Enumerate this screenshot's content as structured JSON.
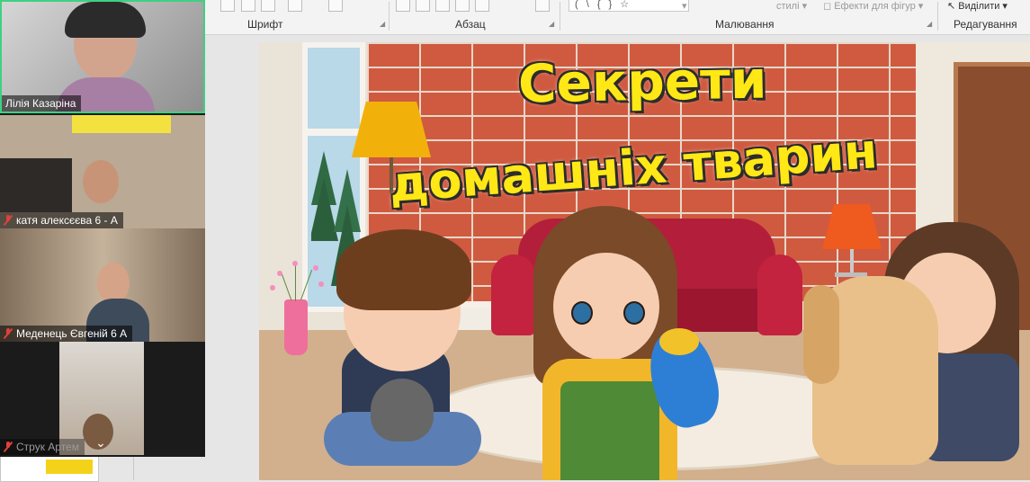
{
  "ribbon": {
    "groups": {
      "font": "Шрифт",
      "paragraph": "Абзац",
      "drawing": "Малювання",
      "editing": "Редагування"
    },
    "top_row": {
      "styles": "стилі",
      "shape_effects": "Ефекти для фігур",
      "select": "Виділити"
    },
    "shape_gallery_glyphs": "( \\ { } ☆"
  },
  "slide": {
    "title_line1": "Секрети",
    "title_line2": "домашніх тварин",
    "colors": {
      "title": "#ffe815",
      "brick": "#cf5a40",
      "sofa": "#b31f3a"
    }
  },
  "participants": [
    {
      "name": "Лілія Казаріна",
      "muted": false,
      "active": true
    },
    {
      "name": "катя алексєєва 6 - А",
      "muted": true,
      "active": false
    },
    {
      "name": "Меденець Євгеній 6 А",
      "muted": true,
      "active": false
    },
    {
      "name": "Струк Артем",
      "muted": true,
      "active": false
    }
  ],
  "panel_icons": {
    "expand": "chevron-down-icon",
    "mute": "mic-muted-icon"
  }
}
